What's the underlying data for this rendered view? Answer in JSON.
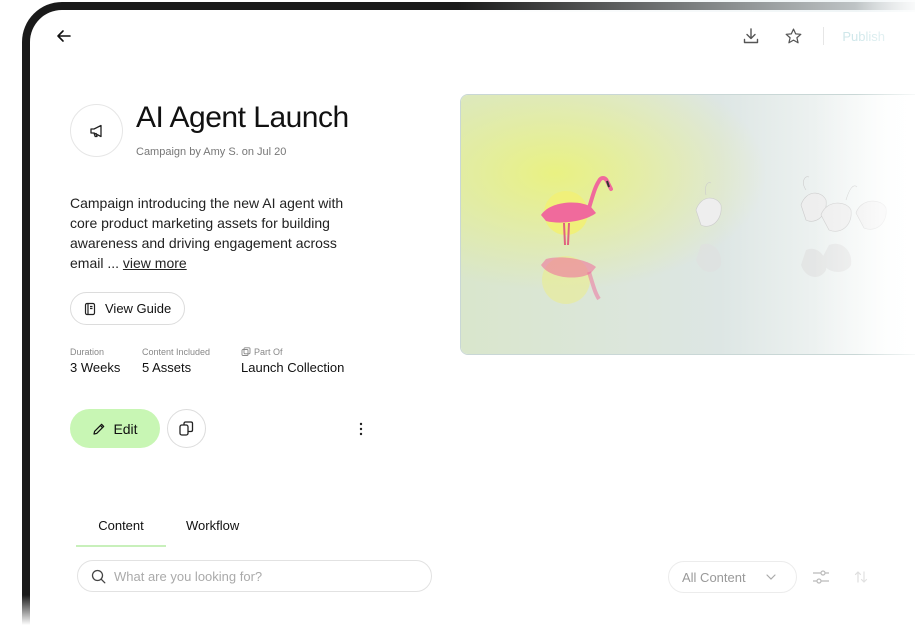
{
  "header": {
    "back_icon": "arrow-left-icon",
    "download_icon": "download-icon",
    "favorite_icon": "star-icon",
    "publish_label": "Publish"
  },
  "campaign": {
    "icon": "megaphone-icon",
    "title": "AI Agent Launch",
    "byline": "Campaign by Amy S. on Jul 20",
    "description": "Campaign introducing the new AI agent with core product marketing assets for building awareness and driving engagement across email ...",
    "view_more": "view more",
    "guide_label": "View Guide",
    "meta": {
      "duration_label": "Duration",
      "duration_value": "3 Weeks",
      "content_label": "Content Included",
      "content_value": "5 Assets",
      "part_of_label": "Part Of",
      "part_of_value": "Launch Collection"
    },
    "edit_label": "Edit"
  },
  "tabs": [
    {
      "label": "Content",
      "active": true
    },
    {
      "label": "Workflow",
      "active": false
    }
  ],
  "search": {
    "placeholder": "What are you looking for?"
  },
  "filter": {
    "selected": "All Content"
  },
  "colors": {
    "accent_green": "#c8f6b4",
    "tab_underline": "#c8f0bb",
    "hero_glow": "#e8f27a",
    "flamingo": "#f06a9c"
  }
}
